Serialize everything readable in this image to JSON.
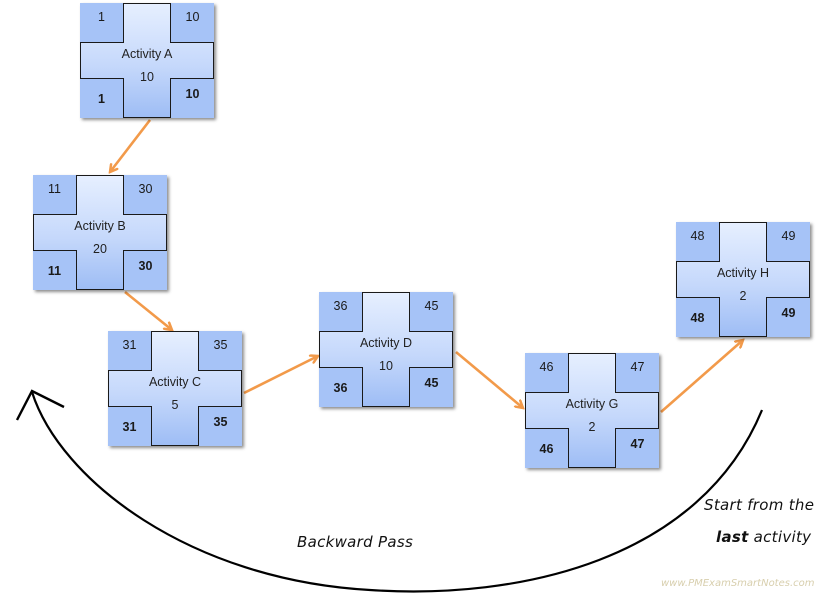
{
  "diagram": {
    "type": "network-diagram",
    "colors": {
      "node_fill": "#c5d8fb",
      "corner_fill": "#a6c3f7",
      "border": "#1a1a1a",
      "dependency_arrow": "#f29a4a",
      "pass_arrow": "#000000",
      "watermark": "#d8cfae"
    },
    "nodes": [
      {
        "id": "A",
        "title": "Activity A",
        "duration": "10",
        "es": "1",
        "ef": "10",
        "ls": "1",
        "lf": "10"
      },
      {
        "id": "B",
        "title": "Activity B",
        "duration": "20",
        "es": "11",
        "ef": "30",
        "ls": "11",
        "lf": "30"
      },
      {
        "id": "C",
        "title": "Activity C",
        "duration": "5",
        "es": "31",
        "ef": "35",
        "ls": "31",
        "lf": "35"
      },
      {
        "id": "D",
        "title": "Activity D",
        "duration": "10",
        "es": "36",
        "ef": "45",
        "ls": "36",
        "lf": "45"
      },
      {
        "id": "G",
        "title": "Activity G",
        "duration": "2",
        "es": "46",
        "ef": "47",
        "ls": "46",
        "lf": "47"
      },
      {
        "id": "H",
        "title": "Activity H",
        "duration": "2",
        "es": "48",
        "ef": "49",
        "ls": "48",
        "lf": "49"
      }
    ],
    "edges": [
      {
        "from": "A",
        "to": "B"
      },
      {
        "from": "B",
        "to": "C"
      },
      {
        "from": "C",
        "to": "D"
      },
      {
        "from": "D",
        "to": "G"
      },
      {
        "from": "G",
        "to": "H"
      }
    ],
    "annotations": {
      "pass_label": "Backward Pass",
      "note_line1": "Start from the",
      "note_bold": "last",
      "note_rest": " activity",
      "watermark": "www.PMExamSmartNotes.com"
    }
  }
}
